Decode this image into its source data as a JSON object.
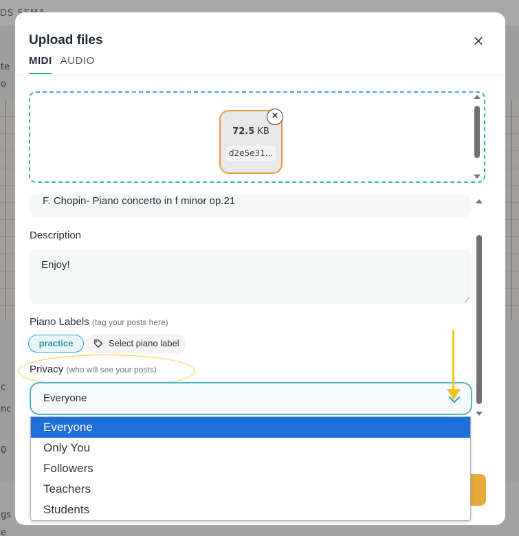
{
  "background": {
    "top_text": "DS SEMA",
    "side_texts": [
      "te",
      "o",
      "c",
      "nc",
      "0",
      "gs",
      "e"
    ]
  },
  "modal": {
    "title": "Upload files",
    "close_symbol": "×",
    "tabs": [
      {
        "label": "MIDI",
        "active": true
      },
      {
        "label": "AUDIO",
        "active": false
      }
    ]
  },
  "dropzone": {
    "file": {
      "size_value": "72.5",
      "size_unit": "KB",
      "name": "d2e5e31...",
      "remove_symbol": "×"
    }
  },
  "form": {
    "title_value": "F. Chopin- Piano concerto in f minor op.21",
    "description_label": "Description",
    "description_value": "Enjoy!",
    "labels_title": "Piano Labels",
    "labels_hint": "(tag your posts here)",
    "chip": "practice",
    "select_label": "Select piano label",
    "privacy_title": "Privacy",
    "privacy_hint": "(who will see your posts)",
    "privacy_value": "Everyone",
    "privacy_options": [
      "Everyone",
      "Only You",
      "Followers",
      "Teachers",
      "Students"
    ]
  },
  "colors": {
    "accent": "#2aa4b4",
    "file_border": "#e89a3c",
    "highlight": "#f5c518",
    "selected_option": "#1e6fd9",
    "submit": "#e8a93c"
  },
  "icons": {
    "close": "close-icon",
    "tag": "tag-icon",
    "chevron": "chevron-down-icon",
    "arrow": "down-arrow-annotation"
  }
}
